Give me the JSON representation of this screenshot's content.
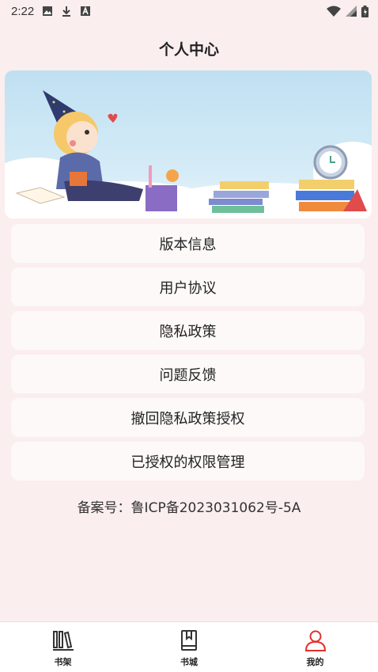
{
  "status_bar": {
    "time": "2:22",
    "icons_left": [
      "image-icon",
      "download-icon",
      "font-a-icon"
    ],
    "icons_right": [
      "wifi-icon",
      "signal-icon",
      "battery-icon"
    ]
  },
  "header": {
    "title": "个人中心"
  },
  "banner": {
    "description": "cartoon girl reading books with clock and pencil cup"
  },
  "menu": {
    "items": [
      {
        "label": "版本信息"
      },
      {
        "label": "用户协议"
      },
      {
        "label": "隐私政策"
      },
      {
        "label": "问题反馈"
      },
      {
        "label": "撤回隐私政策授权"
      },
      {
        "label": "已授权的权限管理"
      }
    ]
  },
  "footer": {
    "icp": "备案号：鲁ICP备2023031062号-5A"
  },
  "bottom_nav": {
    "items": [
      {
        "label": "书架",
        "icon": "bookshelf-icon"
      },
      {
        "label": "书城",
        "icon": "book-icon"
      },
      {
        "label": "我的",
        "icon": "user-icon"
      }
    ],
    "active_index": 2,
    "active_color": "#e0322c"
  }
}
